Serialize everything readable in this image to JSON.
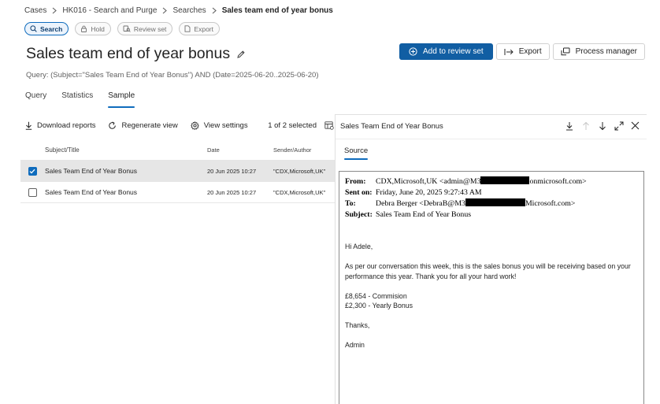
{
  "breadcrumb": [
    "Cases",
    "HK016 - Search and Purge",
    "Searches",
    "Sales team end of year bonus"
  ],
  "pills": [
    {
      "label": "Search",
      "icon": "search-icon",
      "active": true
    },
    {
      "label": "Hold",
      "icon": "lock-icon",
      "active": false
    },
    {
      "label": "Review set",
      "icon": "review-set-icon",
      "active": false
    },
    {
      "label": "Export",
      "icon": "document-icon",
      "active": false
    }
  ],
  "page": {
    "title": "Sales team end of year bonus",
    "query": "Query: (Subject=\"Sales Team End of Year Bonus\") AND (Date=2025-06-20..2025-06-20)"
  },
  "actions": {
    "add_to_review_set": "Add to review set",
    "export": "Export",
    "process_manager": "Process manager"
  },
  "tabs": [
    "Query",
    "Statistics",
    "Sample"
  ],
  "active_tab": "Sample",
  "toolbar": {
    "download_reports": "Download reports",
    "regenerate_view": "Regenerate view",
    "view_settings": "View settings",
    "selected_count": "1 of 2 selected"
  },
  "table": {
    "columns": [
      "Subject/Title",
      "Date",
      "Sender/Author"
    ],
    "rows": [
      {
        "subject": "Sales Team End of Year Bonus",
        "date": "20 Jun 2025 10:27",
        "sender": "\"CDX,Microsoft,UK\"",
        "selected": true
      },
      {
        "subject": "Sales Team End of Year Bonus",
        "date": "20 Jun 2025 10:27",
        "sender": "\"CDX,Microsoft,UK\"",
        "selected": false
      }
    ]
  },
  "preview": {
    "title": "Sales Team End of Year Bonus",
    "tab": "Source",
    "email": {
      "from_label": "From:",
      "from_pre": "CDX,Microsoft,UK <admin@M3",
      "from_post": "onmicrosoft.com>",
      "sent_label": "Sent on:",
      "sent_value": "Friday, June 20, 2025 9:27:43 AM",
      "to_label": "To:",
      "to_pre": "Debra Berger <DebraB@M3",
      "to_post": "Microsoft.com>",
      "subject_label": "Subject:",
      "subject_value": "Sales Team End of Year Bonus",
      "greeting": "Hi Adele,",
      "paragraph": "As per our conversation this week, this is the sales bonus you will be receiving based on your performance this year. Thank you for all your hard work!",
      "line1": "£8,654 - Commision",
      "line2": "£2,300 - Yearly Bonus",
      "thanks": "Thanks,",
      "signature": "Admin"
    }
  },
  "colors": {
    "accent": "#0f6cbd",
    "primary_button": "#115ea3",
    "selected_row": "#e6e6e6"
  }
}
